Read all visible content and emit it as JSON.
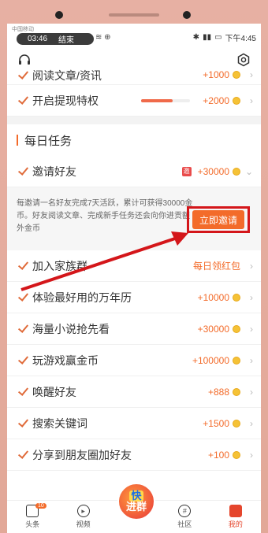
{
  "status_bar": {
    "carrier": "中国移动",
    "recording_time": "03:46",
    "recording_end": "结束",
    "time": "下午4:45"
  },
  "rows_top": [
    {
      "label": "阅读文章/资讯",
      "reward": "+1000"
    },
    {
      "label": "开启提现特权",
      "reward": "+2000",
      "progress": 0.65
    }
  ],
  "section": {
    "title": "每日任务"
  },
  "invite": {
    "label": "邀请好友",
    "badge": "邀",
    "reward": "+30000",
    "description": "每邀请一名好友完成7天活跃，累计可获得30000金币。好友阅读文章、完成新手任务还会向你进贡额外金币",
    "button": "立即邀请"
  },
  "tasks": [
    {
      "label": "加入家族群",
      "reward": "每日领红包"
    },
    {
      "label": "体验最好用的万年历",
      "reward": "+10000"
    },
    {
      "label": "海量小说抢先看",
      "reward": "+30000"
    },
    {
      "label": "玩游戏赢金币",
      "reward": "+100000"
    },
    {
      "label": "唤醒好友",
      "reward": "+888"
    },
    {
      "label": "搜索关键词",
      "reward": "+1500"
    },
    {
      "label": "分享到朋友圈加好友",
      "reward": "+100"
    }
  ],
  "tabbar": {
    "items": [
      {
        "label": "头条",
        "badge": "10"
      },
      {
        "label": "视频"
      },
      {
        "label": ""
      },
      {
        "label": "社区"
      },
      {
        "label": "我的"
      }
    ],
    "center": [
      "快",
      "进群"
    ]
  },
  "colors": {
    "accent": "#f36b2a",
    "highlight": "#d4161a"
  }
}
